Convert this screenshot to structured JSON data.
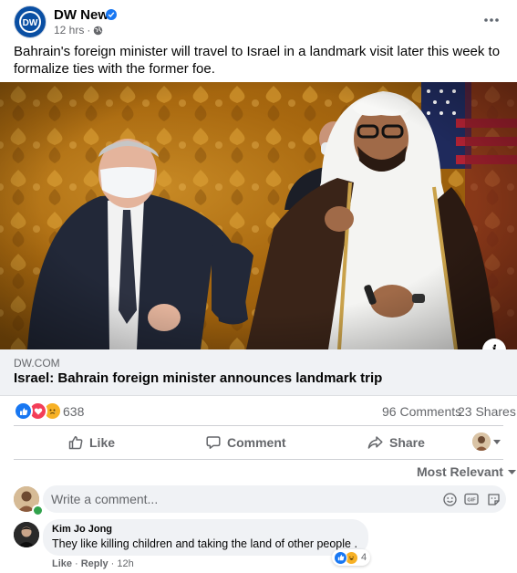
{
  "post": {
    "page_name": "DW News",
    "time": "12 hrs",
    "text": "Bahrain's foreign minister will travel to Israel in a landmark visit later this week to formalize ties with the former foe."
  },
  "link": {
    "domain": "DW.COM",
    "title": "Israel: Bahrain foreign minister announces landmark trip"
  },
  "stats": {
    "reaction_count": "638",
    "comments": "96 Comments",
    "shares": "23 Shares"
  },
  "actions": {
    "like": "Like",
    "comment": "Comment",
    "share": "Share"
  },
  "comments_section": {
    "sort_label": "Most Relevant",
    "input_placeholder": "Write a comment..."
  },
  "comments": [
    {
      "author": "Kim Jo Jong",
      "text": "They like killing children and taking the land of other people .",
      "reaction_count": "4",
      "like_label": "Like",
      "reply_label": "Reply",
      "time": "12h"
    }
  ],
  "colors": {
    "brand_blue": "#1877f2",
    "dw_blue": "#0a4fa3",
    "secondary_text": "#65676b"
  },
  "icons": {
    "logo": "dw-logo",
    "verified": "verified-badge-icon",
    "audience": "globe-icon",
    "more": "more-options-icon",
    "like": "thumbs-up-icon",
    "comment": "speech-bubble-icon",
    "share": "share-arrow-icon",
    "info": "info-icon",
    "emoji": "emoji-icon",
    "gif": "gif-icon",
    "sticker": "sticker-icon"
  }
}
